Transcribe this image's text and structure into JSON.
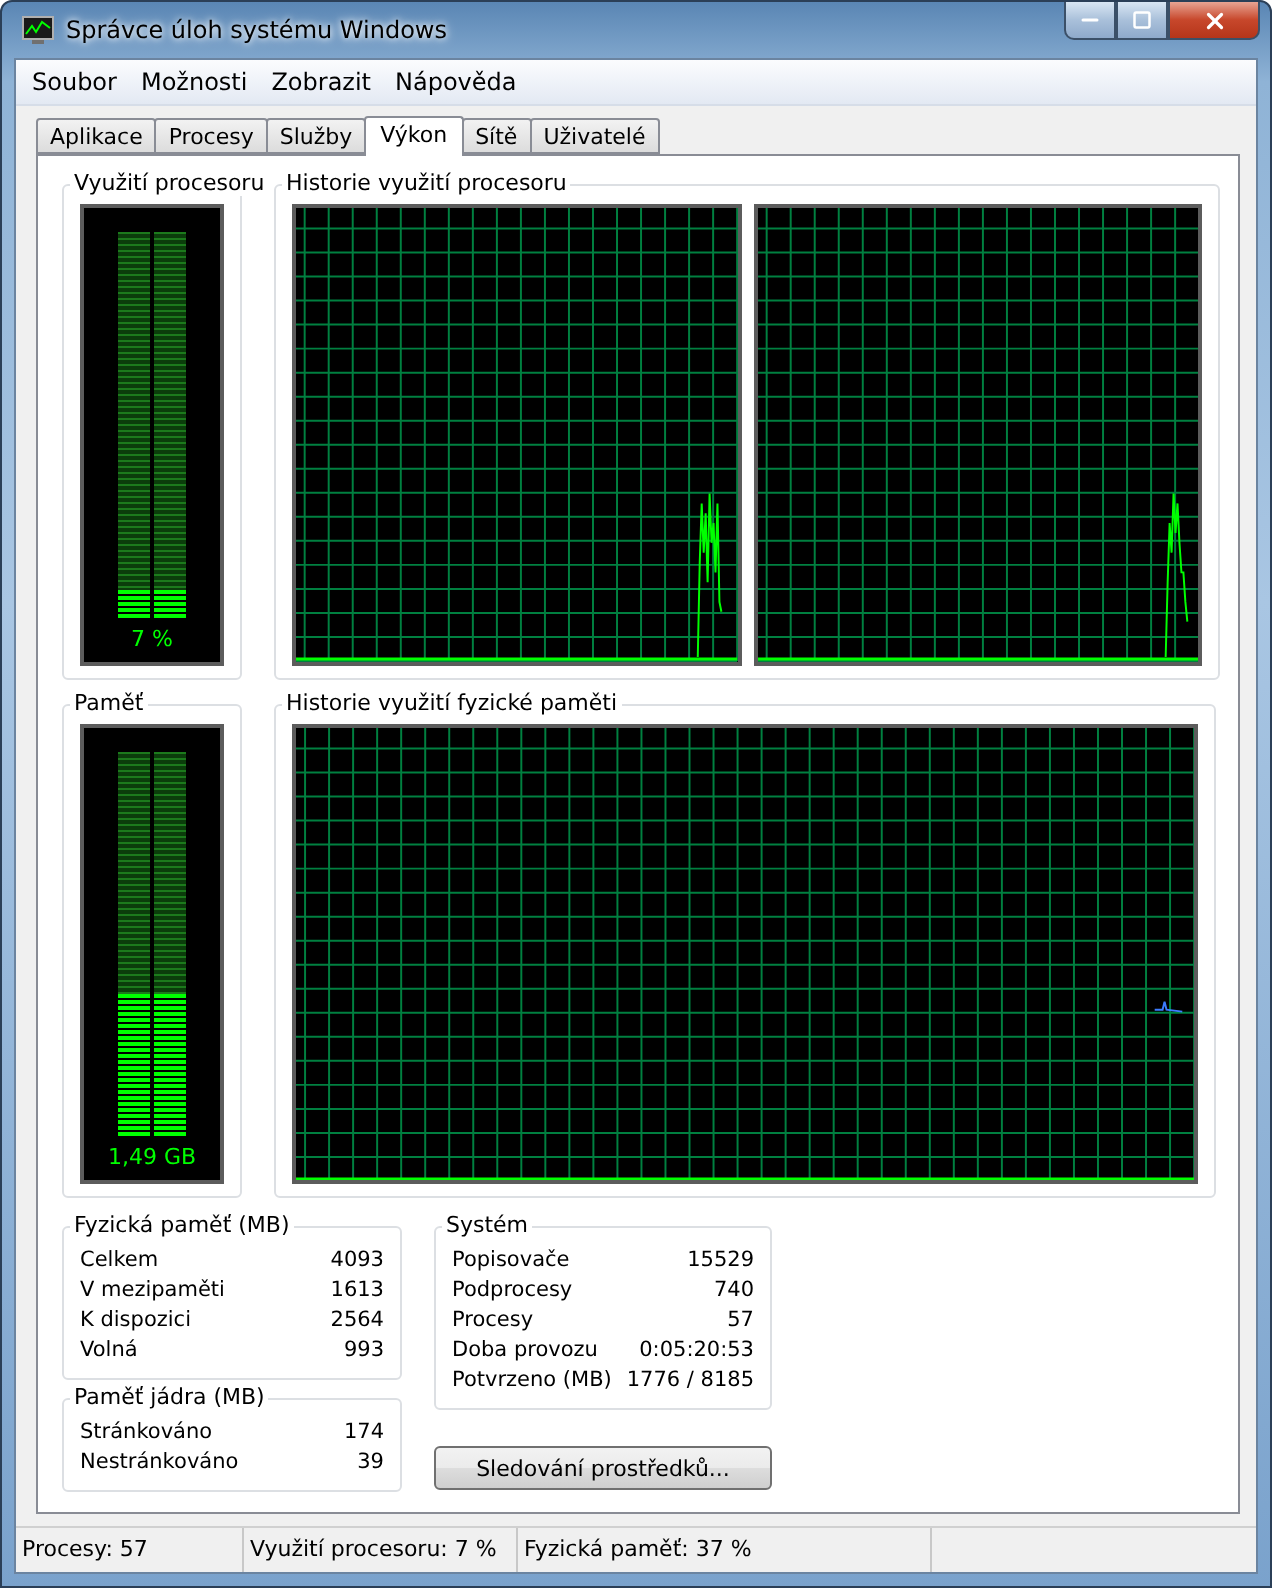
{
  "window": {
    "title": "Správce úloh systému Windows"
  },
  "menu": [
    "Soubor",
    "Možnosti",
    "Zobrazit",
    "Nápověda"
  ],
  "tabs": [
    {
      "label": "Aplikace",
      "selected": false
    },
    {
      "label": "Procesy",
      "selected": false
    },
    {
      "label": "Služby",
      "selected": false
    },
    {
      "label": "Výkon",
      "selected": true
    },
    {
      "label": "Sítě",
      "selected": false
    },
    {
      "label": "Uživatelé",
      "selected": false
    }
  ],
  "cpu_meter": {
    "title": "Využití procesoru",
    "level": 0.07,
    "reading": "7 %"
  },
  "cpu_history": {
    "title": "Historie využití procesoru"
  },
  "memory_meter": {
    "title": "Paměť",
    "level": 0.37,
    "reading": "1,49 GB"
  },
  "memory_history": {
    "title": "Historie využití fyzické paměti"
  },
  "physical_memory": {
    "title": "Fyzická paměť (MB)",
    "rows": [
      {
        "label": "Celkem",
        "value": "4093"
      },
      {
        "label": "V mezipaměti",
        "value": "1613"
      },
      {
        "label": "K dispozici",
        "value": "2564"
      },
      {
        "label": "Volná",
        "value": "993"
      }
    ]
  },
  "kernel_memory": {
    "title": "Paměť jádra (MB)",
    "rows": [
      {
        "label": "Stránkováno",
        "value": "174"
      },
      {
        "label": "Nestránkováno",
        "value": "39"
      }
    ]
  },
  "system": {
    "title": "Systém",
    "rows": [
      {
        "label": "Popisovače",
        "value": "15529"
      },
      {
        "label": "Podprocesy",
        "value": "740"
      },
      {
        "label": "Procesy",
        "value": "57"
      },
      {
        "label": "Doba provozu",
        "value": "0:05:20:53"
      },
      {
        "label": "Potvrzeno (MB)",
        "value": "1776 / 8185"
      }
    ]
  },
  "resource_monitor_button": "Sledování prostředků...",
  "status_bar": [
    "Procesy: 57",
    "Využití procesoru: 7 %",
    "Fyzická paměť: 37 %"
  ]
}
